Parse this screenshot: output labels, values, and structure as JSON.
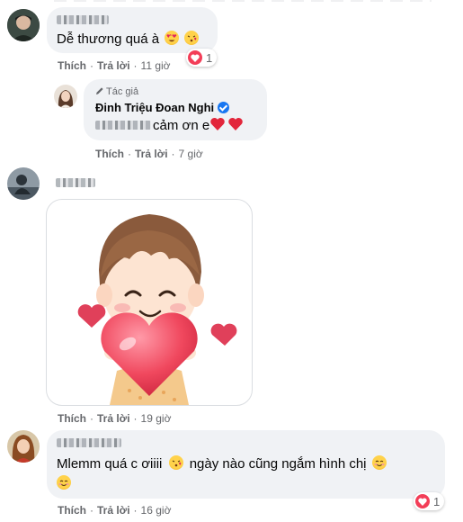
{
  "comment1": {
    "text": "Dễ thương quá à",
    "like_label": "Thích",
    "reply_label": "Trả lời",
    "time": "11 giờ",
    "reaction_count": "1",
    "emojis": [
      "heart-eyes-emoji",
      "kissing-emoji"
    ]
  },
  "reply1": {
    "author_tag": "Tác giả",
    "author_name": "Đinh Triệu Đoan Nghi",
    "text": "cảm ơn e",
    "like_label": "Thích",
    "reply_label": "Trả lời",
    "time": "7 giờ",
    "emojis": [
      "red-heart-emoji",
      "red-heart-emoji"
    ]
  },
  "comment2": {
    "sticker": "boy-holding-heart-sticker",
    "like_label": "Thích",
    "reply_label": "Trả lời",
    "time": "19 giờ"
  },
  "comment3": {
    "text_line1": "Mlemm quá c ơiiii",
    "text_line1b": "ngày nào cũng ngắm hình chị",
    "like_label": "Thích",
    "reply_label": "Trả lời",
    "time": "16 giờ",
    "reaction_count": "1"
  },
  "colors": {
    "bubble": "#f0f2f5",
    "meta_text": "#65676b",
    "heart_reaction": "#f33e58",
    "verified": "#1877f2"
  }
}
